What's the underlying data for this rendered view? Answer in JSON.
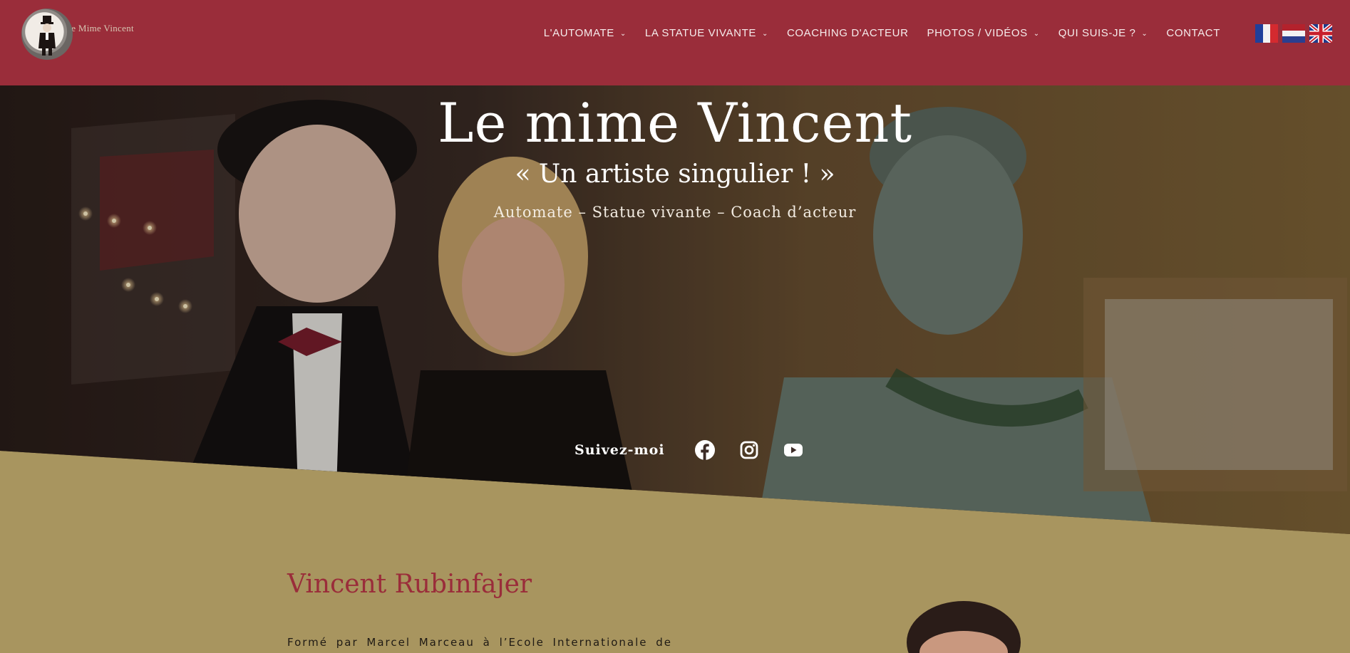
{
  "header": {
    "logo_text": "Le Mime Vincent",
    "nav": [
      {
        "label": "L'AUTOMATE",
        "dropdown": true
      },
      {
        "label": "LA STATUE VIVANTE",
        "dropdown": true
      },
      {
        "label": "COACHING D'ACTEUR",
        "dropdown": false
      },
      {
        "label": "PHOTOS / VIDÉOS",
        "dropdown": true
      },
      {
        "label": "QUI SUIS-JE ?",
        "dropdown": true
      },
      {
        "label": "CONTACT",
        "dropdown": false
      }
    ],
    "languages": [
      "fr",
      "nl",
      "en"
    ],
    "chevron_glyph": "⌄",
    "colors": {
      "bar": "#9a2d3a",
      "text": "#f6ecec"
    }
  },
  "hero": {
    "title": "Le mime Vincent",
    "subtitle": "« Un artiste singulier ! »",
    "tagline": "Automate – Statue vivante – Coach d’acteur",
    "follow_label": "Suivez-moi",
    "socials": [
      "facebook-icon",
      "instagram-icon",
      "youtube-icon"
    ]
  },
  "content": {
    "name": "Vincent Rubinfajer",
    "intro": "Formé par Marcel Marceau à l’Ecole Internationale de",
    "background_color": "#a8955f",
    "accent_color": "#9a2d3a"
  }
}
